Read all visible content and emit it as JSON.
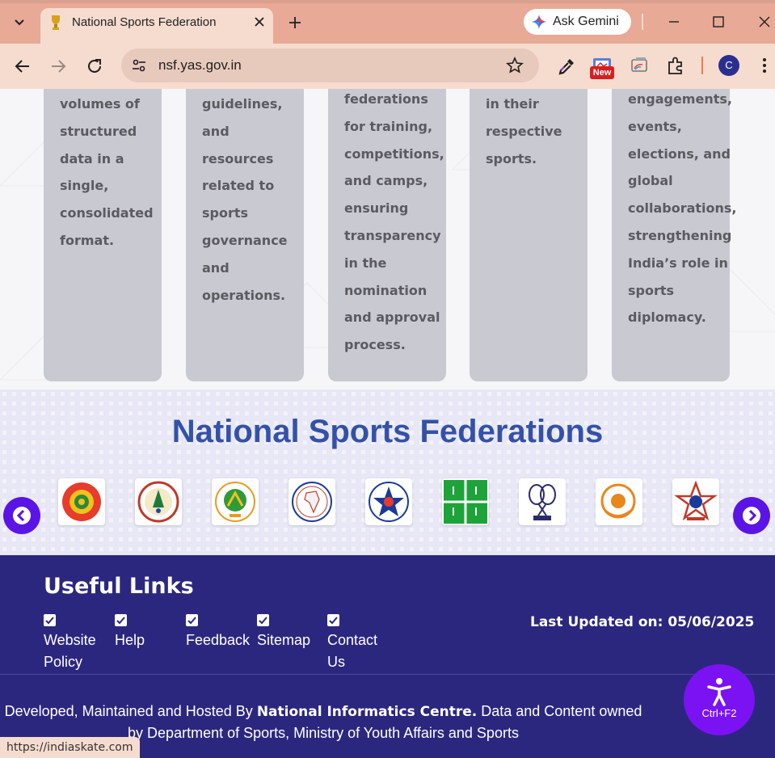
{
  "browser": {
    "tab_title": "National Sports Federation",
    "ask_gemini": "Ask Gemini",
    "url": "nsf.yas.gov.in",
    "new_badge": "New",
    "profile_initial": "C",
    "status_url": "https://indiaskate.com"
  },
  "feature_cards": [
    {
      "lines": [
        "volumes of",
        "structured",
        "data in a",
        "single,",
        "consolidated",
        "format."
      ]
    },
    {
      "lines": [
        "guidelines,",
        "and",
        "resources",
        "related to",
        "sports",
        "governance",
        "and",
        "operations."
      ]
    },
    {
      "lines": [
        "federations",
        "for training,",
        "competitions,",
        "and camps,",
        "ensuring",
        "transparency",
        "in the",
        "nomination",
        "and approval",
        "process."
      ]
    },
    {
      "lines": [
        "in their",
        "respective",
        "sports."
      ]
    },
    {
      "lines": [
        "engagements,",
        "events,",
        "elections, and",
        "global",
        "collaborations,",
        "strengthening",
        "India’s role in",
        "sports",
        "diplomacy."
      ]
    }
  ],
  "federations": {
    "title": "National Sports Federations",
    "logos": [
      "federation-logo-1",
      "federation-logo-2",
      "federation-logo-3",
      "federation-logo-4",
      "federation-logo-5",
      "federation-logo-6",
      "federation-logo-7",
      "federation-logo-8",
      "federation-logo-9"
    ]
  },
  "footer": {
    "useful_links_title": "Useful Links",
    "links": [
      {
        "lines": [
          "Website",
          "Policy"
        ]
      },
      {
        "lines": [
          "Help"
        ]
      },
      {
        "lines": [
          "Feedback"
        ]
      },
      {
        "lines": [
          "Sitemap"
        ]
      },
      {
        "lines": [
          "Contact",
          "Us"
        ]
      }
    ],
    "last_updated": "Last Updated on: 05/06/2025",
    "credit_prefix": "Developed, Maintained and Hosted By",
    "credit_org": "National Informatics Centre.",
    "credit_suffix": "Data and Content owned",
    "credit_line2": "by Department of Sports, Ministry of Youth Affairs and Sports"
  },
  "accessibility": {
    "shortcut": "Ctrl+F2"
  },
  "colors": {
    "heading_blue": "#3451a8",
    "footer_bg": "#2c277e",
    "arrow_purple": "#5b14e6",
    "a11y_purple": "#7b12f3",
    "card_grey": "#c9c9d2"
  }
}
